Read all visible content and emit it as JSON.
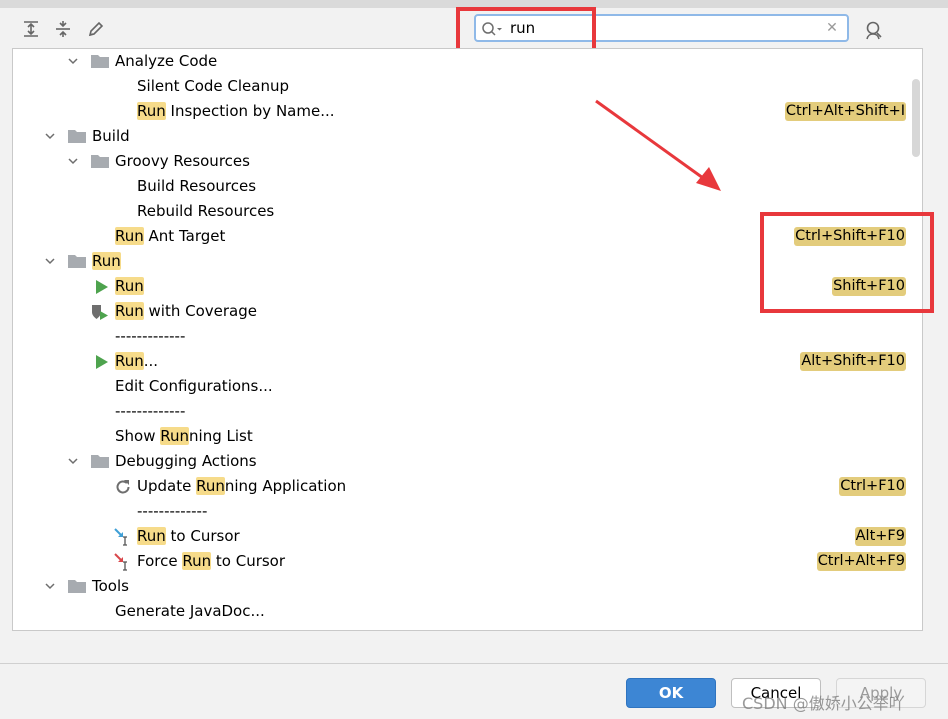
{
  "search": {
    "value": "run"
  },
  "tree": {
    "rows": [
      {
        "label_pre": "",
        "label_hl": "",
        "label_post": "Analyze Code",
        "shortcut": ""
      },
      {
        "label_pre": "",
        "label_hl": "",
        "label_post": "Silent Code Cleanup",
        "shortcut": ""
      },
      {
        "label_pre": "",
        "label_hl": "Run",
        "label_post": " Inspection by Name...",
        "shortcut": "Ctrl+Alt+Shift+I"
      },
      {
        "label_pre": "",
        "label_hl": "",
        "label_post": "Build",
        "shortcut": ""
      },
      {
        "label_pre": "",
        "label_hl": "",
        "label_post": "Groovy Resources",
        "shortcut": ""
      },
      {
        "label_pre": "",
        "label_hl": "",
        "label_post": "Build Resources",
        "shortcut": ""
      },
      {
        "label_pre": "",
        "label_hl": "",
        "label_post": "Rebuild Resources",
        "shortcut": ""
      },
      {
        "label_pre": "",
        "label_hl": "Run",
        "label_post": " Ant Target",
        "shortcut": "Ctrl+Shift+F10"
      },
      {
        "label_pre": "",
        "label_hl": "Run",
        "label_post": "",
        "shortcut": ""
      },
      {
        "label_pre": "",
        "label_hl": "Run",
        "label_post": "",
        "shortcut": "Shift+F10"
      },
      {
        "label_pre": "",
        "label_hl": "Run",
        "label_post": " with Coverage",
        "shortcut": ""
      },
      {
        "label_pre": "",
        "label_hl": "",
        "label_post": "-------------",
        "shortcut": ""
      },
      {
        "label_pre": "",
        "label_hl": "Run",
        "label_post": "...",
        "shortcut": "Alt+Shift+F10"
      },
      {
        "label_pre": "",
        "label_hl": "",
        "label_post": "Edit Configurations...",
        "shortcut": ""
      },
      {
        "label_pre": "",
        "label_hl": "",
        "label_post": "-------------",
        "shortcut": ""
      },
      {
        "label_pre": "Show ",
        "label_hl": "Run",
        "label_post": "ning List",
        "shortcut": ""
      },
      {
        "label_pre": "",
        "label_hl": "",
        "label_post": "Debugging Actions",
        "shortcut": ""
      },
      {
        "label_pre": "Update ",
        "label_hl": "Run",
        "label_post": "ning Application",
        "shortcut": "Ctrl+F10"
      },
      {
        "label_pre": "",
        "label_hl": "",
        "label_post": "-------------",
        "shortcut": ""
      },
      {
        "label_pre": "",
        "label_hl": "Run",
        "label_post": " to Cursor",
        "shortcut": "Alt+F9"
      },
      {
        "label_pre": "Force ",
        "label_hl": "Run",
        "label_post": " to Cursor",
        "shortcut": "Ctrl+Alt+F9"
      },
      {
        "label_pre": "",
        "label_hl": "",
        "label_post": "Tools",
        "shortcut": ""
      },
      {
        "label_pre": "",
        "label_hl": "",
        "label_post": "Generate JavaDoc...",
        "shortcut": ""
      }
    ]
  },
  "buttons": {
    "ok": "OK",
    "cancel": "Cancel",
    "apply": "Apply"
  },
  "watermark": "CSDN @傲娇小公举吖",
  "colors": {
    "highlight": "#f6db8a",
    "shortcut_bg": "#e3cc7c",
    "annotation": "#e8383c",
    "ok_button": "#3d86d4"
  }
}
